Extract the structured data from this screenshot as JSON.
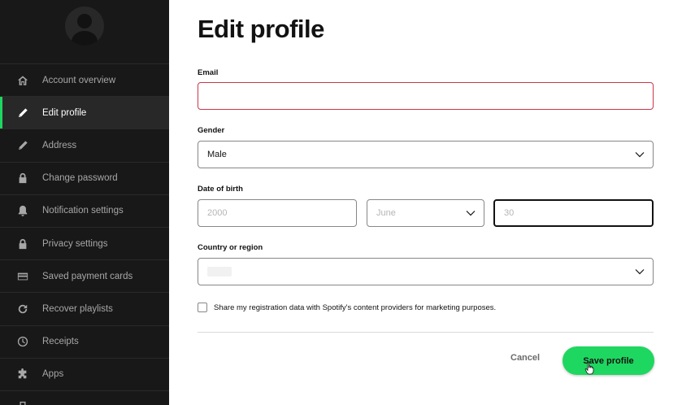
{
  "sidebar": {
    "items": [
      {
        "label": "Account overview",
        "icon": "home-icon",
        "active": false
      },
      {
        "label": "Edit profile",
        "icon": "pencil-icon",
        "active": true
      },
      {
        "label": "Address",
        "icon": "pencil-icon",
        "active": false
      },
      {
        "label": "Change password",
        "icon": "lock-icon",
        "active": false
      },
      {
        "label": "Notification settings",
        "icon": "bell-icon",
        "active": false
      },
      {
        "label": "Privacy settings",
        "icon": "lock-icon",
        "active": false
      },
      {
        "label": "Saved payment cards",
        "icon": "card-icon",
        "active": false
      },
      {
        "label": "Recover playlists",
        "icon": "recover-icon",
        "active": false
      },
      {
        "label": "Receipts",
        "icon": "clock-icon",
        "active": false
      },
      {
        "label": "Apps",
        "icon": "puzzle-icon",
        "active": false
      }
    ]
  },
  "main": {
    "title": "Edit profile",
    "email": {
      "label": "Email",
      "value": ""
    },
    "gender": {
      "label": "Gender",
      "value": "Male"
    },
    "dob": {
      "label": "Date of birth",
      "year": "2000",
      "month": "June",
      "day": "30"
    },
    "country": {
      "label": "Country or region"
    },
    "marketing_checkbox": {
      "label": "Share my registration data with Spotify's content providers for marketing purposes.",
      "checked": false
    },
    "cancel_label": "Cancel",
    "save_label": "Save profile"
  },
  "colors": {
    "accent": "#1ed760",
    "error": "#c9374a",
    "sidebar_bg": "#181818"
  }
}
